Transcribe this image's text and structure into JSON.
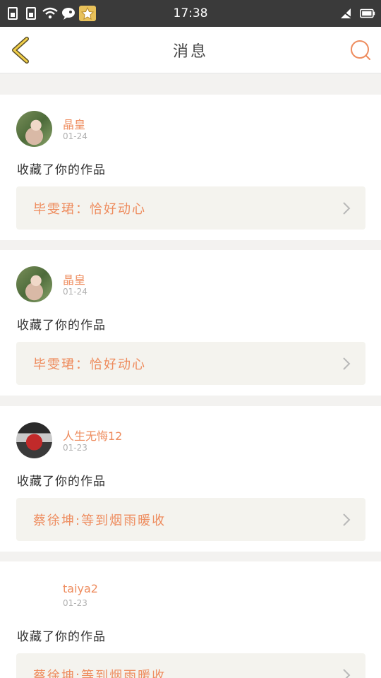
{
  "status_bar": {
    "time": "17:38",
    "icons_left": [
      "sim-icon",
      "sim-icon",
      "wifi-icon",
      "message-icon",
      "app-badge-icon"
    ],
    "icons_right": [
      "no-signal-icon",
      "battery-icon"
    ]
  },
  "header": {
    "title": "消息",
    "back_icon": "chevron-left-icon",
    "search_icon": "search-icon",
    "accent_color": "#ee8c5e"
  },
  "messages": [
    {
      "user": "晶皇",
      "time": "01-24",
      "action": "收藏了你的作品",
      "work": "毕雯珺：恰好动心"
    },
    {
      "user": "晶皇",
      "time": "01-24",
      "action": "收藏了你的作品",
      "work": "毕雯珺：恰好动心"
    },
    {
      "user": "人生无悔12",
      "time": "01-23",
      "action": "收藏了你的作品",
      "work": "蔡徐坤:等到烟雨暖收"
    },
    {
      "user": "taiya2",
      "time": "01-23",
      "action": "收藏了你的作品",
      "work": "蔡徐坤:等到烟雨暖收"
    }
  ]
}
